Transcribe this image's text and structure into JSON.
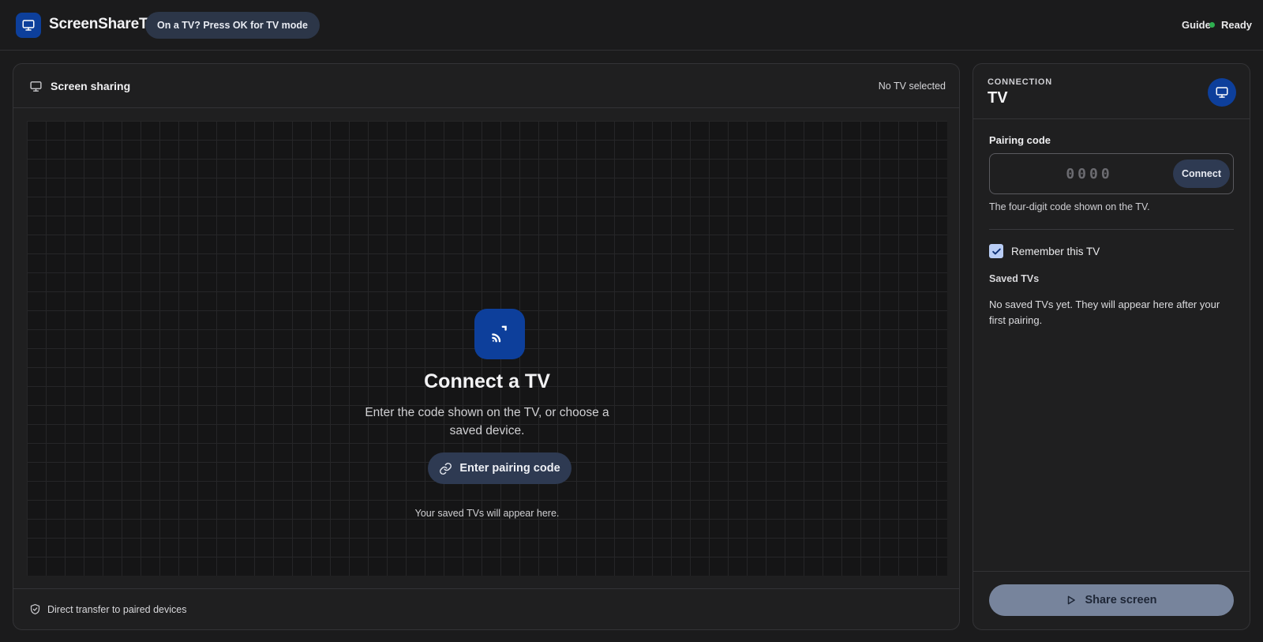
{
  "header": {
    "app_title": "ScreenShareTV",
    "tv_hint": "On a TV? Press OK for TV mode",
    "guide_label": "Guide",
    "status_text": "Ready",
    "status_color": "#2eae4f"
  },
  "main": {
    "title": "Screen sharing",
    "selection_status": "No TV selected",
    "stage": {
      "heading": "Connect a TV",
      "subtitle": "Enter the code shown on the TV, or choose a saved device.",
      "pair_button_label": "Enter pairing code",
      "note": "Your saved TVs will appear here."
    },
    "footer_text": "Direct transfer to paired devices"
  },
  "side": {
    "eyebrow": "CONNECTION",
    "title": "TV",
    "pairing": {
      "label": "Pairing code",
      "placeholder": "0000",
      "value": "",
      "connect_label": "Connect",
      "help": "The four-digit code shown on the TV."
    },
    "remember": {
      "label": "Remember this TV",
      "checked": true
    },
    "saved": {
      "heading": "Saved TVs",
      "empty_message": "No saved TVs yet. They will appear here after your first pairing."
    },
    "share_button_label": "Share screen"
  },
  "icons": {
    "logo": "monitor-icon",
    "panel": "monitor-icon",
    "cast": "cast-icon",
    "link": "link-icon",
    "shield": "shield-check-icon",
    "badge": "monitor-icon",
    "check": "check-icon",
    "play": "play-icon"
  },
  "colors": {
    "accent": "#0d3f9b",
    "background": "#1b1b1c",
    "panel": "#1f1f20",
    "button": "#2e3a52",
    "share_button": "#77849c"
  }
}
